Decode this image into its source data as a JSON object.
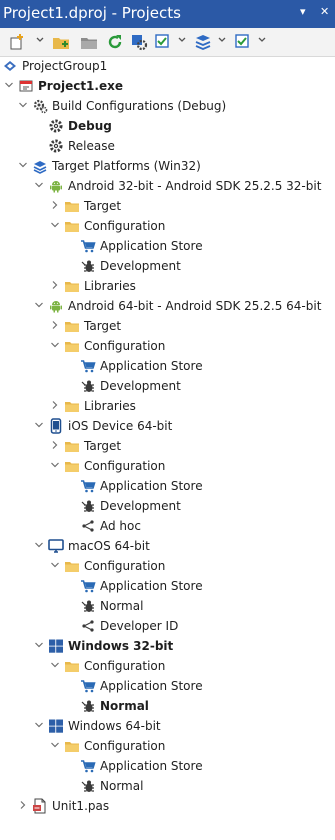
{
  "window": {
    "title": "Project1.dproj - Projects",
    "pin_glyph": "▾",
    "close_glyph": "✕"
  },
  "toolbar": {
    "buttons": [
      "new-item-icon",
      "add-project-icon",
      "open-folder-icon",
      "refresh-icon",
      "build-groups-icon",
      "activate-icon",
      "build-all-icon",
      "sync-icon"
    ]
  },
  "tree": [
    {
      "label": "ProjectGroup1",
      "icon": "project-group-icon",
      "depth": 0,
      "expander": "none",
      "bold": false
    },
    {
      "label": "Project1.exe",
      "icon": "project-exe-icon",
      "depth": 0,
      "expander": "open",
      "bold": true
    },
    {
      "label": "Build Configurations (Debug)",
      "icon": "build-config-icon",
      "depth": 1,
      "expander": "open",
      "bold": false
    },
    {
      "label": "Debug",
      "icon": "gear-icon",
      "depth": 2,
      "expander": "none",
      "bold": true
    },
    {
      "label": "Release",
      "icon": "gear-icon",
      "depth": 2,
      "expander": "none",
      "bold": false
    },
    {
      "label": "Target Platforms (Win32)",
      "icon": "platforms-icon",
      "depth": 1,
      "expander": "open",
      "bold": false
    },
    {
      "label": "Android 32-bit - Android SDK 25.2.5 32-bit",
      "icon": "android-icon",
      "depth": 2,
      "expander": "open",
      "bold": false
    },
    {
      "label": "Target",
      "icon": "folder-icon",
      "depth": 3,
      "expander": "closed",
      "bold": false
    },
    {
      "label": "Configuration",
      "icon": "folder-icon",
      "depth": 3,
      "expander": "open",
      "bold": false
    },
    {
      "label": "Application Store",
      "icon": "cart-icon",
      "depth": 4,
      "expander": "none",
      "bold": false
    },
    {
      "label": "Development",
      "icon": "bug-icon",
      "depth": 4,
      "expander": "none",
      "bold": false
    },
    {
      "label": "Libraries",
      "icon": "folder-icon",
      "depth": 3,
      "expander": "closed",
      "bold": false
    },
    {
      "label": "Android 64-bit - Android SDK 25.2.5 64-bit",
      "icon": "android-icon",
      "depth": 2,
      "expander": "open",
      "bold": false
    },
    {
      "label": "Target",
      "icon": "folder-icon",
      "depth": 3,
      "expander": "closed",
      "bold": false
    },
    {
      "label": "Configuration",
      "icon": "folder-icon",
      "depth": 3,
      "expander": "open",
      "bold": false
    },
    {
      "label": "Application Store",
      "icon": "cart-icon",
      "depth": 4,
      "expander": "none",
      "bold": false
    },
    {
      "label": "Development",
      "icon": "bug-icon",
      "depth": 4,
      "expander": "none",
      "bold": false
    },
    {
      "label": "Libraries",
      "icon": "folder-icon",
      "depth": 3,
      "expander": "closed",
      "bold": false
    },
    {
      "label": "iOS Device 64-bit",
      "icon": "ios-device-icon",
      "depth": 2,
      "expander": "open",
      "bold": false
    },
    {
      "label": "Target",
      "icon": "folder-icon",
      "depth": 3,
      "expander": "closed",
      "bold": false
    },
    {
      "label": "Configuration",
      "icon": "folder-icon",
      "depth": 3,
      "expander": "open",
      "bold": false
    },
    {
      "label": "Application Store",
      "icon": "cart-icon",
      "depth": 4,
      "expander": "none",
      "bold": false
    },
    {
      "label": "Development",
      "icon": "bug-icon",
      "depth": 4,
      "expander": "none",
      "bold": false
    },
    {
      "label": "Ad hoc",
      "icon": "share-icon",
      "depth": 4,
      "expander": "none",
      "bold": false
    },
    {
      "label": "macOS 64-bit",
      "icon": "monitor-icon",
      "depth": 2,
      "expander": "open",
      "bold": false
    },
    {
      "label": "Configuration",
      "icon": "folder-icon",
      "depth": 3,
      "expander": "open",
      "bold": false
    },
    {
      "label": "Application Store",
      "icon": "cart-icon",
      "depth": 4,
      "expander": "none",
      "bold": false
    },
    {
      "label": "Normal",
      "icon": "bug-icon",
      "depth": 4,
      "expander": "none",
      "bold": false
    },
    {
      "label": "Developer ID",
      "icon": "share-icon",
      "depth": 4,
      "expander": "none",
      "bold": false
    },
    {
      "label": "Windows 32-bit",
      "icon": "windows-icon",
      "depth": 2,
      "expander": "open",
      "bold": true
    },
    {
      "label": "Configuration",
      "icon": "folder-icon",
      "depth": 3,
      "expander": "open",
      "bold": false
    },
    {
      "label": "Application Store",
      "icon": "cart-icon",
      "depth": 4,
      "expander": "none",
      "bold": false
    },
    {
      "label": "Normal",
      "icon": "bug-icon",
      "depth": 4,
      "expander": "none",
      "bold": true
    },
    {
      "label": "Windows 64-bit",
      "icon": "windows-icon",
      "depth": 2,
      "expander": "open",
      "bold": false
    },
    {
      "label": "Configuration",
      "icon": "folder-icon",
      "depth": 3,
      "expander": "open",
      "bold": false
    },
    {
      "label": "Application Store",
      "icon": "cart-icon",
      "depth": 4,
      "expander": "none",
      "bold": false
    },
    {
      "label": "Normal",
      "icon": "bug-icon",
      "depth": 4,
      "expander": "none",
      "bold": false
    },
    {
      "label": "Unit1.pas",
      "icon": "source-file-icon",
      "depth": 1,
      "expander": "closed",
      "bold": false
    }
  ],
  "colors": {
    "titlebar": "#2b59a6",
    "folder": "#e8b84a",
    "android": "#7cb342",
    "windows": "#2d5fa8",
    "cart": "#2a6ab5",
    "expander": "#6e6e6e"
  }
}
